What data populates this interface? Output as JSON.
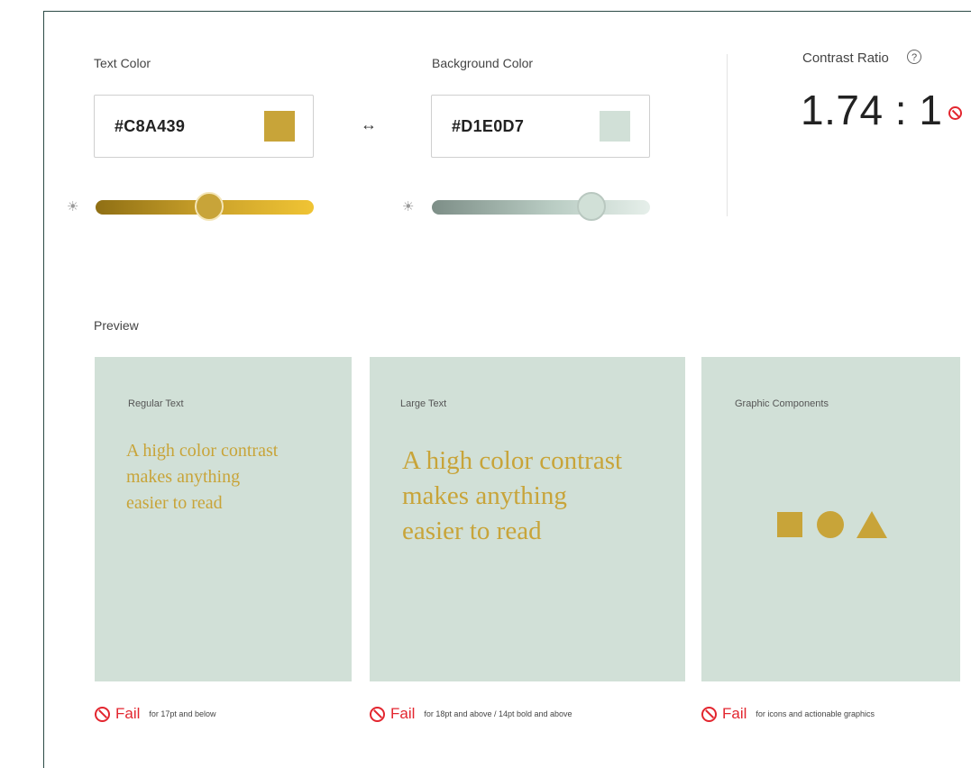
{
  "text_color": {
    "label": "Text Color",
    "hex": "#C8A439",
    "swatch_color": "#C8A439",
    "brightness_slider_level": 0.52,
    "brightness_icon": "sun-icon"
  },
  "swap_icon": "swap-arrows-icon",
  "swap_glyph": "↔",
  "background_color": {
    "label": "Background Color",
    "hex": "#D1E0D7",
    "swatch_color": "#D1E0D7",
    "brightness_slider_level": 0.73,
    "brightness_icon": "sun-icon"
  },
  "contrast": {
    "label": "Contrast Ratio",
    "help_glyph": "?",
    "value": "1.74 : 1",
    "status_icon": "fail-icon",
    "status_color": "#e3262f"
  },
  "preview": {
    "label": "Preview",
    "cards": [
      {
        "title": "Regular Text",
        "text": "A high color contrast makes anything easier to read",
        "fail_label": "Fail",
        "fail_desc": "for 17pt and below"
      },
      {
        "title": "Large Text",
        "text": "A high color contrast makes anything easier to read",
        "fail_label": "Fail",
        "fail_desc": "for 18pt and above / 14pt bold and above"
      },
      {
        "title": "Graphic Components",
        "shapes": [
          "square-icon",
          "circle-icon",
          "triangle-icon"
        ],
        "fail_label": "Fail",
        "fail_desc": "for icons and actionable graphics"
      }
    ]
  }
}
